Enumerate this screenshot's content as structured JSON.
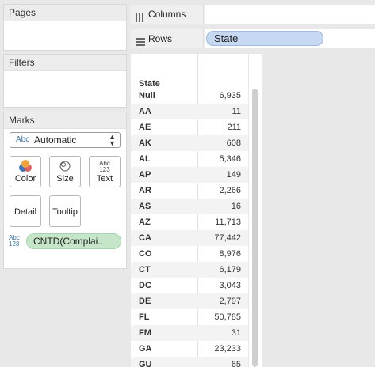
{
  "pages": {
    "title": "Pages"
  },
  "filters": {
    "title": "Filters"
  },
  "marks": {
    "title": "Marks",
    "mark_type": {
      "icon_text": "Abc",
      "value": "Automatic"
    },
    "buttons": {
      "color": "Color",
      "size": "Size",
      "text": "Text",
      "text_icon_top": "Abc",
      "text_icon_bottom": "123",
      "detail": "Detail",
      "tooltip": "Tooltip"
    },
    "pill": {
      "icon_top": "Abc",
      "icon_bottom": "123",
      "label": "CNTD(Complai.."
    }
  },
  "shelves": {
    "columns_label": "Columns",
    "rows_label": "Rows",
    "rows_pill": "State"
  },
  "table": {
    "header": "State",
    "rows": [
      {
        "state": "Null",
        "value": "6,935"
      },
      {
        "state": "AA",
        "value": "11"
      },
      {
        "state": "AE",
        "value": "211"
      },
      {
        "state": "AK",
        "value": "608"
      },
      {
        "state": "AL",
        "value": "5,346"
      },
      {
        "state": "AP",
        "value": "149"
      },
      {
        "state": "AR",
        "value": "2,266"
      },
      {
        "state": "AS",
        "value": "16"
      },
      {
        "state": "AZ",
        "value": "11,713"
      },
      {
        "state": "CA",
        "value": "77,442"
      },
      {
        "state": "CO",
        "value": "8,976"
      },
      {
        "state": "CT",
        "value": "6,179"
      },
      {
        "state": "DC",
        "value": "3,043"
      },
      {
        "state": "DE",
        "value": "2,797"
      },
      {
        "state": "FL",
        "value": "50,785"
      },
      {
        "state": "FM",
        "value": "31"
      },
      {
        "state": "GA",
        "value": "23,233"
      },
      {
        "state": "GU",
        "value": "65"
      }
    ]
  },
  "colors": {
    "state_pill": "#c6d8f2",
    "measure_pill": "#c5e6c8",
    "panel_header": "#ececec"
  }
}
